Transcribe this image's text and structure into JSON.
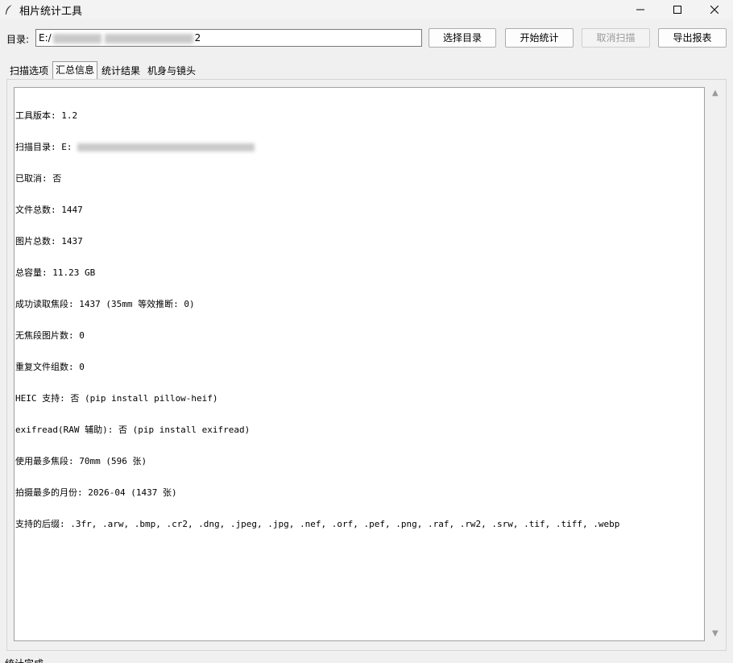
{
  "window": {
    "title": "相片统计工具",
    "icon": "feather-icon",
    "controls": [
      "minimize-icon",
      "maximize-icon",
      "close-icon"
    ]
  },
  "directory": {
    "label": "目录:",
    "value_prefix": "E:/",
    "value_suffix": "2"
  },
  "toolbar": {
    "select_dir": "选择目录",
    "start": "开始统计",
    "cancel": "取消扫描",
    "export": "导出报表"
  },
  "tabs": [
    {
      "label": "扫描选项",
      "active": false
    },
    {
      "label": "汇总信息",
      "active": true
    },
    {
      "label": "统计结果",
      "active": false
    },
    {
      "label": "机身与镜头",
      "active": false
    }
  ],
  "summary_lines": [
    "工具版本: 1.2",
    "扫描目录: E:",
    "已取消: 否",
    "文件总数: 1447",
    "图片总数: 1437",
    "总容量: 11.23 GB",
    "成功读取焦段: 1437 (35mm 等效推断: 0)",
    "无焦段图片数: 0",
    "重复文件组数: 0",
    "HEIC 支持: 否 (pip install pillow-heif)",
    "exifread(RAW 辅助): 否 (pip install exifread)",
    "使用最多焦段: 70mm (596 张)",
    "拍摄最多的月份: 2026-04 (1437 张)",
    "支持的后缀: .3fr, .arw, .bmp, .cr2, .dng, .jpeg, .jpg, .nef, .orf, .pef, .png, .raf, .rw2, .srw, .tif, .tiff, .webp"
  ],
  "status": "统计完成"
}
